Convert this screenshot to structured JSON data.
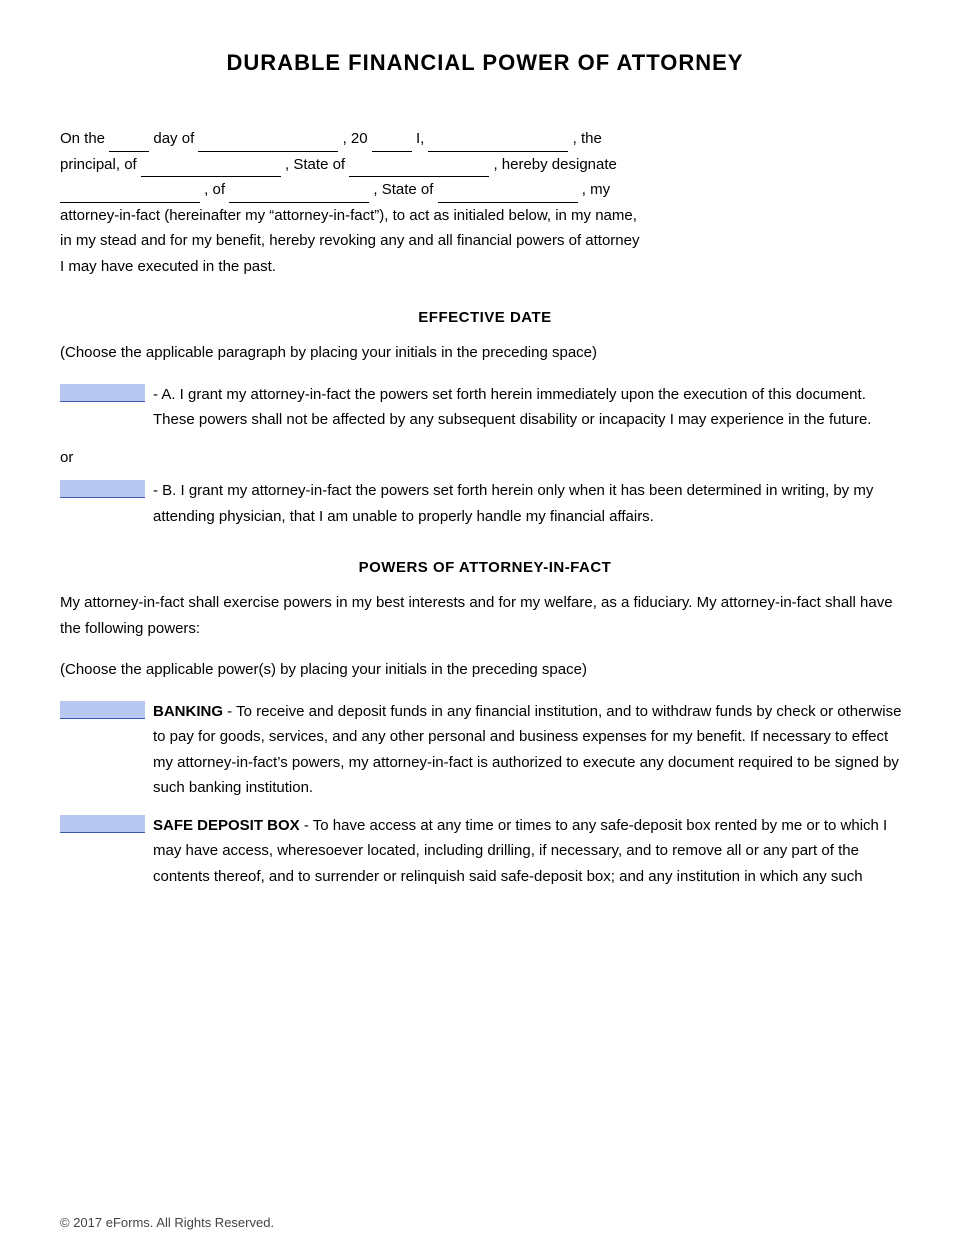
{
  "document": {
    "title": "DURABLE FINANCIAL POWER OF ATTORNEY",
    "intro": {
      "line1_pre": "On the",
      "blank_day": "",
      "line1_mid1": "day of",
      "blank_date": "",
      "line1_mid2": ", 20",
      "blank_year": "",
      "line1_mid3": "I,",
      "blank_principal_name": "",
      "line1_end": ", the",
      "line2_pre": "principal, of",
      "blank_principal_address": "",
      "line2_mid": ", State of",
      "blank_principal_state": "",
      "line2_end": ", hereby designate",
      "line3_blank1": "",
      "line3_mid1": ", of",
      "line3_blank2": "",
      "line3_mid2": ", State of",
      "line3_blank3": "",
      "line3_end": ", my",
      "line4": "attorney-in-fact (hereinafter my “attorney-in-fact”), to act as initialed below, in my name,",
      "line5": "in my stead and for my benefit, hereby revoking any and all financial powers of attorney",
      "line6": "I may have executed in the past."
    },
    "section1": {
      "title": "EFFECTIVE DATE",
      "choose_text": "(Choose the applicable paragraph by placing your initials in the preceding space)",
      "option_a": {
        "label": "- A. I grant my attorney-in-fact the powers set forth herein immediately upon the execution of this document. These powers shall not be affected by any subsequent disability or incapacity I may experience in the future."
      },
      "or_text": "or",
      "option_b": {
        "label": "- B. I grant my attorney-in-fact the powers set forth herein only when it has been determined in writing, by my attending physician, that I am unable to properly handle my financial affairs."
      }
    },
    "section2": {
      "title": "POWERS OF ATTORNEY-IN-FACT",
      "intro1": "My attorney-in-fact shall exercise powers in my best interests and for my welfare, as a fiduciary. My attorney-in-fact shall have the following powers:",
      "choose_text": "(Choose the applicable power(s) by placing your initials in the preceding space)",
      "banking": {
        "heading": "BANKING",
        "text": "- To receive and deposit funds in any financial institution, and to withdraw funds by check or otherwise to pay for goods, services, and any other personal and business expenses for my benefit.  If necessary to effect my attorney-in-fact’s powers, my attorney-in-fact is authorized to execute any document required to be signed by such banking institution."
      },
      "safe_deposit": {
        "heading": "SAFE DEPOSIT BOX",
        "text": "- To have access at any time or times to any safe-deposit box rented by me or to which I may have access, wheresoever located, including drilling, if necessary, and to remove all or any part of the contents thereof, and to surrender or relinquish said safe-deposit box; and any institution in which any such"
      }
    },
    "footer": {
      "copyright": "© 2017 eForms. All Rights Reserved."
    }
  }
}
